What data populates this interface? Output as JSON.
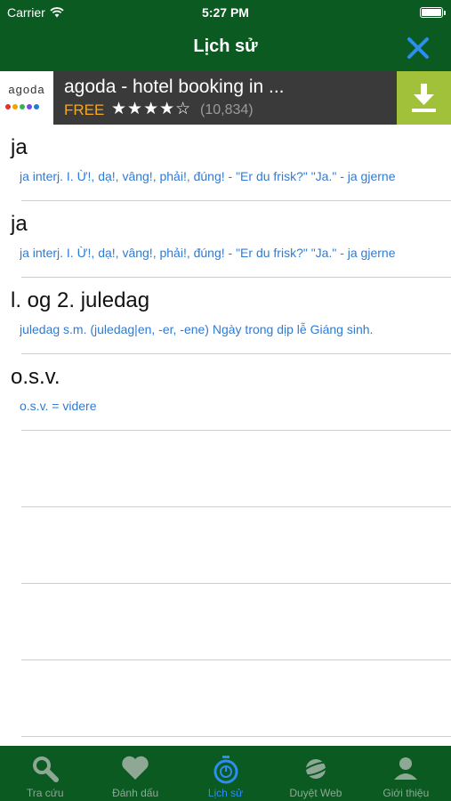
{
  "status": {
    "carrier": "Carrier",
    "time": "5:27 PM"
  },
  "nav": {
    "title": "Lịch sử"
  },
  "ad": {
    "logo_text": "agoda",
    "app_name": "agoda - hotel booking in ...",
    "price": "FREE",
    "stars": "★★★★☆",
    "rating_count": "(10,834)"
  },
  "history": [
    {
      "word": "ja",
      "definition": "ja  interj.    I. Ừ!, dạ!, vâng!, phải!, đúng! -   \"Er du frisk?\"  \"Ja.\" -   ja gjerne"
    },
    {
      "word": "ja",
      "definition": "ja  interj.    I. Ừ!, dạ!, vâng!, phải!, đúng! -   \"Er du frisk?\"  \"Ja.\" -   ja gjerne"
    },
    {
      "word": "l. og 2. juledag",
      "definition": "juledag  s.m. (juledag|en, -er, -ene)     Ngày trong dịp lễ Giáng sinh."
    },
    {
      "word": "o.s.v.",
      "definition": "o.s.v.  =  videre"
    },
    {
      "word": "",
      "definition": ""
    },
    {
      "word": "",
      "definition": ""
    },
    {
      "word": "",
      "definition": ""
    },
    {
      "word": "",
      "definition": ""
    }
  ],
  "tabs": [
    {
      "label": "Tra cứu",
      "icon": "search-icon"
    },
    {
      "label": "Đánh dấu",
      "icon": "heart-icon"
    },
    {
      "label": "Lịch sử",
      "icon": "stopwatch-icon"
    },
    {
      "label": "Duyệt Web",
      "icon": "planet-icon"
    },
    {
      "label": "Giới thiệu",
      "icon": "person-icon"
    }
  ],
  "colors": {
    "bar_green": "#0b5a22",
    "accent_blue": "#2b8ef0",
    "definition_blue": "#2f7bd4",
    "download_green": "#a2c13a"
  }
}
